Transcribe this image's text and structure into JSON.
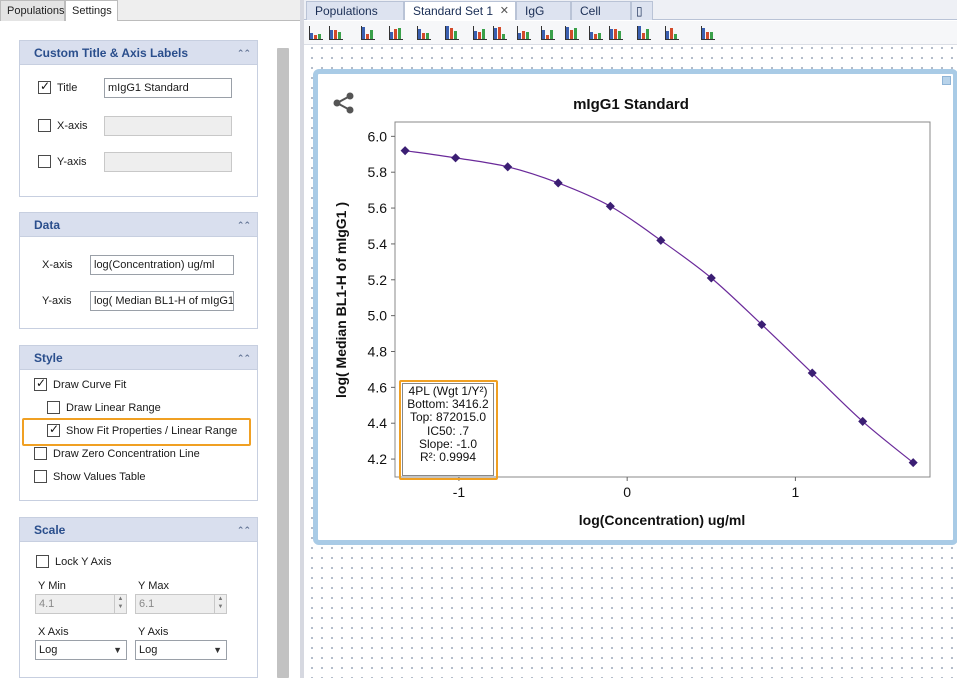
{
  "left_tabs": [
    {
      "label": "Populations"
    },
    {
      "label": "Settings"
    }
  ],
  "panels": {
    "custom_title": {
      "header": "Custom Title & Axis Labels",
      "title": {
        "label": "Title",
        "checked": true,
        "value": "mIgG1 Standard"
      },
      "xaxis": {
        "label": "X-axis",
        "checked": false,
        "value": ""
      },
      "yaxis": {
        "label": "Y-axis",
        "checked": false,
        "value": ""
      }
    },
    "data": {
      "header": "Data",
      "xaxis_label": "X-axis",
      "xaxis_value": "log(Concentration) ug/ml",
      "yaxis_label": "Y-axis",
      "yaxis_value": "log( Median BL1-H of mIgG1"
    },
    "style": {
      "header": "Style",
      "draw_curve_fit": {
        "label": "Draw Curve Fit",
        "checked": true
      },
      "draw_linear_range": {
        "label": "Draw Linear Range",
        "checked": false
      },
      "show_fit_properties": {
        "label": "Show Fit Properties / Linear Range",
        "checked": true
      },
      "draw_zero_concentration": {
        "label": "Draw Zero Concentration Line",
        "checked": false
      },
      "show_values_table": {
        "label": "Show Values Table",
        "checked": false
      }
    },
    "scale": {
      "header": "Scale",
      "lock_y_axis": {
        "label": "Lock Y Axis",
        "checked": false
      },
      "y_min_label": "Y Min",
      "y_min_value": "4.1",
      "y_max_label": "Y Max",
      "y_max_value": "6.1",
      "x_axis_label": "X Axis",
      "x_axis_value": "Log",
      "y_axis_label": "Y Axis",
      "y_axis_value": "Log"
    }
  },
  "right_tabs": [
    {
      "label": "Populations"
    },
    {
      "label": "Standard Set 1",
      "active": true,
      "close": "✕"
    },
    {
      "label": "IgG"
    },
    {
      "label": "Cell"
    }
  ],
  "toolbar_icons": [
    "plot-icon",
    "add-plot-icon",
    "histogram-icon",
    "bar-chart-icon",
    "scatter-icon",
    "density-icon",
    "contour-icon",
    "sum-icon",
    "heatmap-icon",
    "grid-icon",
    "standard-curve-icon",
    "table-icon",
    "gate-icon",
    "list-icon",
    "layout-icon",
    "arrange-icon"
  ],
  "fit_box": {
    "lines": [
      "4PL (Wgt 1/Y²)",
      "Bottom: 3416.2",
      "Top: 872015.0",
      "IC50: .7",
      "Slope: -1.0",
      "R²: 0.9994"
    ]
  },
  "chart_data": {
    "type": "scatter",
    "title": "mIgG1 Standard",
    "xlabel": "log(Concentration) ug/ml",
    "ylabel": "log( Median BL1-H of mIgG1 )",
    "xlim": [
      -1.38,
      1.8
    ],
    "ylim": [
      4.1,
      6.08
    ],
    "x_ticks": [
      -1,
      0,
      1
    ],
    "y_ticks": [
      4.2,
      4.4,
      4.6,
      4.8,
      5.0,
      5.2,
      5.4,
      5.6,
      5.8,
      6.0
    ],
    "points": [
      {
        "x": -1.32,
        "y": 5.92
      },
      {
        "x": -1.02,
        "y": 5.88
      },
      {
        "x": -0.71,
        "y": 5.83
      },
      {
        "x": -0.41,
        "y": 5.74
      },
      {
        "x": -0.1,
        "y": 5.61
      },
      {
        "x": 0.2,
        "y": 5.42
      },
      {
        "x": 0.5,
        "y": 5.21
      },
      {
        "x": 0.8,
        "y": 4.95
      },
      {
        "x": 1.1,
        "y": 4.68
      },
      {
        "x": 1.4,
        "y": 4.41
      },
      {
        "x": 1.7,
        "y": 4.18
      }
    ],
    "curve": "4PL fit",
    "point_color": "#3b1e73",
    "curve_color": "#6a2a9a",
    "grid": false
  },
  "colors": {
    "panel_header": "#d9dfee",
    "panel_header_text": "#2a4e8c",
    "highlight": "#f0a023",
    "card_border": "#a9cbe6"
  }
}
